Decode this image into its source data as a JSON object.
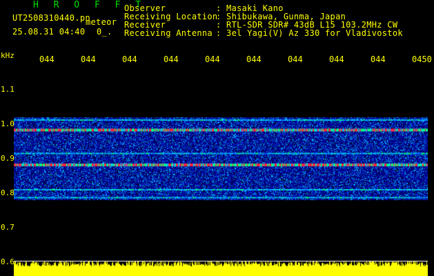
{
  "header": {
    "app_name": "H R O F F T",
    "filename": "UT2508310440.pn",
    "mode": "meteor",
    "datetime": "25.08.31 04:40",
    "mark": "0_.",
    "observer_label": "Observer",
    "observer_value": ": Masaki Kano",
    "location_label": "Receiving Location",
    "location_value": ": Shibukawa, Gunma, Japan",
    "receiver_label": "Receiver",
    "receiver_value": ": RTL-SDR SDR# 43dB L15 103.2MHz CW",
    "antenna_label": "Receiving Antenna",
    "antenna_value": ": 3el Yagi(V) Az 330 for Vladivostok"
  },
  "chart_data": {
    "type": "heatmap",
    "ylabel": "kHz",
    "x_ticks": [
      "044",
      "044",
      "044",
      "044",
      "044",
      "044",
      "044",
      "044",
      "044",
      "0450"
    ],
    "y_ticks": [
      "1.1",
      "1.0",
      "0.9",
      "0.8",
      "0.7",
      "0.6"
    ],
    "ylim": [
      0.6,
      1.15
    ],
    "signal_band": [
      0.78,
      1.02
    ],
    "bright_lines": [
      0.983,
      0.882,
      0.915,
      0.81,
      0.787,
      1.012
    ],
    "colors": {
      "background": "#000000",
      "noise": "#0000c0",
      "signal": "#00c0ff",
      "strong": "#ff2040",
      "spectrum": "#ffff00"
    }
  }
}
